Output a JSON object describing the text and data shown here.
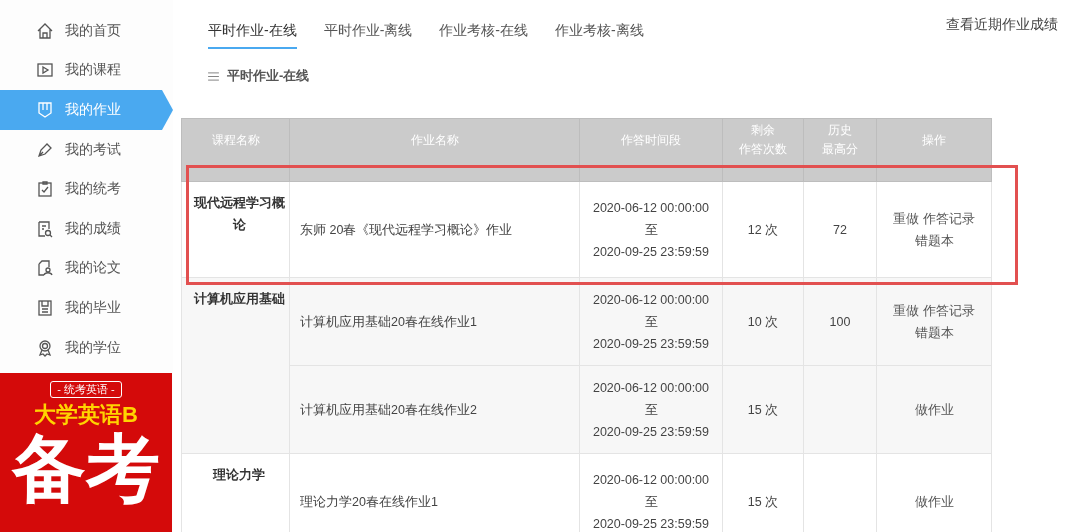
{
  "sidebar": {
    "items": [
      {
        "label": "我的首页",
        "selected": false
      },
      {
        "label": "我的课程",
        "selected": false
      },
      {
        "label": "我的作业",
        "selected": true
      },
      {
        "label": "我的考试",
        "selected": false
      },
      {
        "label": "我的统考",
        "selected": false
      },
      {
        "label": "我的成绩",
        "selected": false
      },
      {
        "label": "我的论文",
        "selected": false
      },
      {
        "label": "我的毕业",
        "selected": false
      },
      {
        "label": "我的学位",
        "selected": false
      }
    ],
    "banner": {
      "tag": "- 统考英语 -",
      "title": "大学英语B",
      "headline": "备考"
    }
  },
  "tabs": [
    {
      "label": "平时作业-在线",
      "selected": true
    },
    {
      "label": "平时作业-离线",
      "selected": false
    },
    {
      "label": "作业考核-在线",
      "selected": false
    },
    {
      "label": "作业考核-离线",
      "selected": false
    }
  ],
  "recent_scores_link": "查看近期作业成绩",
  "section_title": "平时作业-在线",
  "table": {
    "columns": [
      [
        "课程名称"
      ],
      [
        "作业名称"
      ],
      [
        "作答时间段"
      ],
      [
        "剩余",
        "作答次数"
      ],
      [
        "历史",
        "最高分"
      ],
      [
        "操作"
      ]
    ],
    "groups": [
      {
        "course": "现代远程学习概论",
        "rows": [
          {
            "name": "东师 20春《现代远程学习概论》作业",
            "start": "2020-06-12 00:00:00",
            "sep": "至",
            "end": "2020-09-25 23:59:59",
            "remaining": "12 次",
            "best": "72",
            "actions": [
              "重做",
              "作答记录",
              "错题本"
            ]
          }
        ]
      },
      {
        "course": "计算机应用基础",
        "rows": [
          {
            "name": "计算机应用基础20春在线作业1",
            "start": "2020-06-12 00:00:00",
            "sep": "至",
            "end": "2020-09-25 23:59:59",
            "remaining": "10 次",
            "best": "100",
            "actions": [
              "重做",
              "作答记录",
              "错题本"
            ]
          },
          {
            "name": "计算机应用基础20春在线作业2",
            "start": "2020-06-12 00:00:00",
            "sep": "至",
            "end": "2020-09-25 23:59:59",
            "remaining": "15 次",
            "actions": [
              "做作业"
            ]
          }
        ]
      },
      {
        "course": "理论力学",
        "rows": [
          {
            "name": "理论力学20春在线作业1",
            "start": "2020-06-12 00:00:00",
            "sep": "至",
            "end": "2020-09-25 23:59:59",
            "remaining": "15 次",
            "actions": [
              "做作业"
            ]
          }
        ]
      }
    ]
  },
  "highlight": {
    "kind": "annotation"
  }
}
